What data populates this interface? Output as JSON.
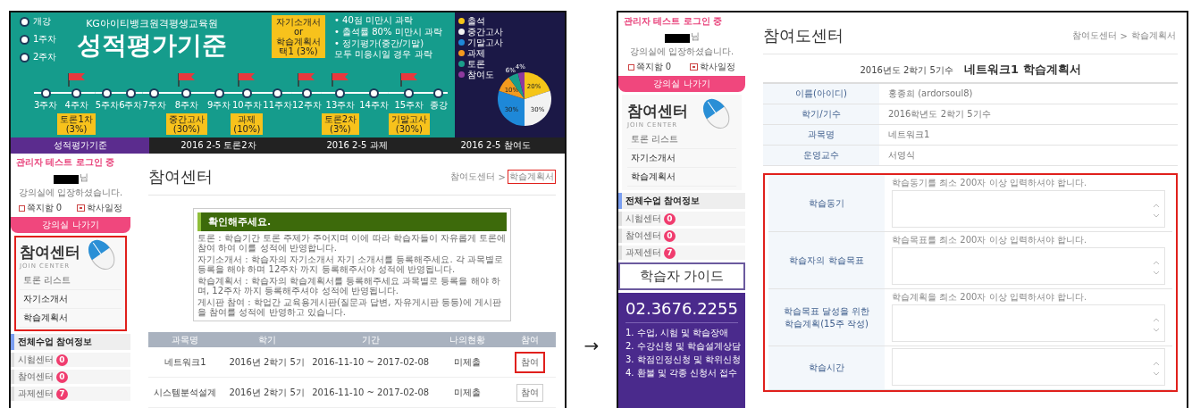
{
  "left_shot": {
    "banner": {
      "subtitle": "KG아이티뱅크원격평생교육원",
      "title": "성적평가기준",
      "early_stops": [
        "개강",
        "1주차",
        "2주차"
      ],
      "top_note": "자기소개서\nor\n학습계획서\n택1 (3%)",
      "rules": [
        "• 40점 미만시 과락",
        "• 출석률 80% 미만시 과락",
        "• 정기평가(중간/기말)\n모두 미응시일 경우 과락"
      ],
      "stops": [
        {
          "label": "3주차",
          "flag": false
        },
        {
          "label": "4주차",
          "flag": true,
          "callout": "토론1차 (3%)"
        },
        {
          "label": "5주차",
          "flag": false
        },
        {
          "label": "6주차",
          "flag": false
        },
        {
          "label": "7주차",
          "flag": false
        },
        {
          "label": "8주차",
          "flag": true,
          "callout": "중간고사 (30%)"
        },
        {
          "label": "9주차",
          "flag": false
        },
        {
          "label": "10주차",
          "flag": true,
          "callout": "과제 (10%)"
        },
        {
          "label": "11주차",
          "flag": false
        },
        {
          "label": "12주차",
          "flag": true
        },
        {
          "label": "13주차",
          "flag": true,
          "callout": "토론2차 (3%)"
        },
        {
          "label": "14주차",
          "flag": false
        },
        {
          "label": "15주차",
          "flag": true,
          "callout": "기말고사 (30%)"
        },
        {
          "label": "종강",
          "flag": false
        }
      ],
      "legend": [
        {
          "label": "출석",
          "color": "#f5c518"
        },
        {
          "label": "중간고사",
          "color": "#f2f2f2"
        },
        {
          "label": "기말고사",
          "color": "#1e88d8"
        },
        {
          "label": "과제",
          "color": "#f39a1e"
        },
        {
          "label": "토론",
          "color": "#1a9e8a"
        },
        {
          "label": "참여도",
          "color": "#8e3a9e"
        }
      ],
      "chart_data": {
        "type": "pie",
        "values": [
          20,
          30,
          30,
          10,
          6,
          4
        ],
        "value_labels": [
          "20%",
          "30%",
          "30%",
          "10%",
          "6%",
          "4%"
        ]
      }
    },
    "tabs": [
      {
        "label": "성적평가기준",
        "selected": true
      },
      {
        "label": "2016 2-5 토론2차",
        "selected": false
      },
      {
        "label": "2016 2-5 과제",
        "selected": false
      },
      {
        "label": "2016 2-5 참여도",
        "selected": false
      }
    ],
    "sidebar": {
      "login_status": "관리자 테스트 로그인 중",
      "name_suffix": "님",
      "welcome": "강의실에 입장하셨습니다.",
      "mailbox": "쪽지함 0",
      "schedule": "학사일정",
      "exit_button": "강의실 나가기",
      "join_center": {
        "title": "참여센터",
        "subtitle": "JOIN CENTER",
        "highlighted": true,
        "menu": [
          "토론 리스트",
          "자기소개서",
          "학습계획서"
        ]
      },
      "participation": {
        "title": "전체수업 참여정보",
        "items": [
          {
            "label": "시험센터",
            "count": "0"
          },
          {
            "label": "참여센터",
            "count": "0"
          },
          {
            "label": "과제센터",
            "count": "7"
          }
        ]
      }
    },
    "main": {
      "title": "참여센터",
      "breadcrumb": {
        "separator": ">",
        "items": [
          {
            "label": "참여도센터",
            "highlighted": false
          },
          {
            "label": "학습계획서",
            "highlighted": true
          }
        ]
      },
      "notice": {
        "title": "확인해주세요.",
        "lines": [
          "토론 : 학습기간 토론 주제가 주어지며 이에 따라 학습자들이 자유롭게 토론에 참여 하여 이를 성적에 반영합니다.",
          "자기소개서 : 학습자의 자기소개서 자기 소개서를 등록해주세요. 각 과목별로 등록을 해야 하며 12주차 까지 등록해주서야 성적에 반영됩니다.",
          "학습계획서 : 학습자의 학습계획서를 등록해주세요 과목별로 등록을 해야 하며, 12주차 까지 등록해주셔야 성적에 반영됩니다.",
          "게시판 참여 : 학업간 교육용게시판(질문과 답변, 자유게시판 등등)에 게시판을 참여를 성적에 반영하고 있습니다."
        ]
      },
      "table": {
        "columns": [
          "과목명",
          "학기",
          "기간",
          "나의현황",
          "참여"
        ],
        "rows": [
          {
            "cells": [
              "네트워크1",
              "2016년 2학기 5기",
              "2016-11-10 ~ 2017-02-08",
              "미제출"
            ],
            "button": "참여",
            "highlighted": true
          },
          {
            "cells": [
              "시스템분석설계",
              "2016년 2학기 5기",
              "2016-11-10 ~ 2017-02-08",
              "미제출"
            ],
            "button": "참여",
            "highlighted": false
          }
        ]
      }
    }
  },
  "arrow": "→",
  "right_shot": {
    "sidebar": {
      "login_status": "관리자 테스트 로그인 중",
      "name_suffix": "님",
      "welcome": "강의실에 입장하셨습니다.",
      "mailbox": "쪽지함 0",
      "schedule": "학사일정",
      "exit_button": "강의실 나가기",
      "join_center": {
        "title": "참여센터",
        "subtitle": "JOIN CENTER",
        "highlighted": false,
        "menu": [
          "토론 리스트",
          "자기소개서",
          "학습계획서"
        ]
      },
      "participation": {
        "title": "전체수업 참여정보",
        "items": [
          {
            "label": "시험센터",
            "count": "0"
          },
          {
            "label": "참여센터",
            "count": "0"
          },
          {
            "label": "과제센터",
            "count": "7"
          }
        ]
      },
      "guide_button": "학습자 가이드",
      "contact": {
        "phone": "02.3676.2255",
        "items": [
          "1. 수업, 시험 및 학습장애",
          "2. 수강신청 및 학습설계상담",
          "3. 학점인정신청 및 학위신청",
          "4. 환불 및 각종 신청서 접수"
        ]
      }
    },
    "main": {
      "title": "참여도센터",
      "breadcrumb": {
        "separator": ">",
        "items": [
          {
            "label": "참여도센터",
            "highlighted": false
          },
          {
            "label": "학습계획서",
            "highlighted": false
          }
        ]
      },
      "doc_term": "2016년도 2학기 5기수",
      "doc_title": "네트워크1 학습계획서",
      "info": [
        {
          "label": "이름(아이디)",
          "value": "홍종희 (ardorsoul8)"
        },
        {
          "label": "학기/기수",
          "value": "2016학년도 2학기 5기수"
        },
        {
          "label": "과목명",
          "value": "네트워크1"
        },
        {
          "label": "운영교수",
          "value": "서영식"
        }
      ],
      "form": {
        "highlighted": true,
        "rows": [
          {
            "label": "학습동기",
            "hint": "학습동기를 최소 200자 이상 입력하셔야 합니다."
          },
          {
            "label": "학습자의 학습목표",
            "hint": "학습목표를 최소 200자 이상 입력하셔야 합니다."
          },
          {
            "label": "학습목표 달성을 위한\n학습계획(15주 작성)",
            "hint": "학습계획을 최소 200자 이상 입력하셔야 합니다."
          },
          {
            "label": "학습시간"
          }
        ]
      }
    }
  }
}
